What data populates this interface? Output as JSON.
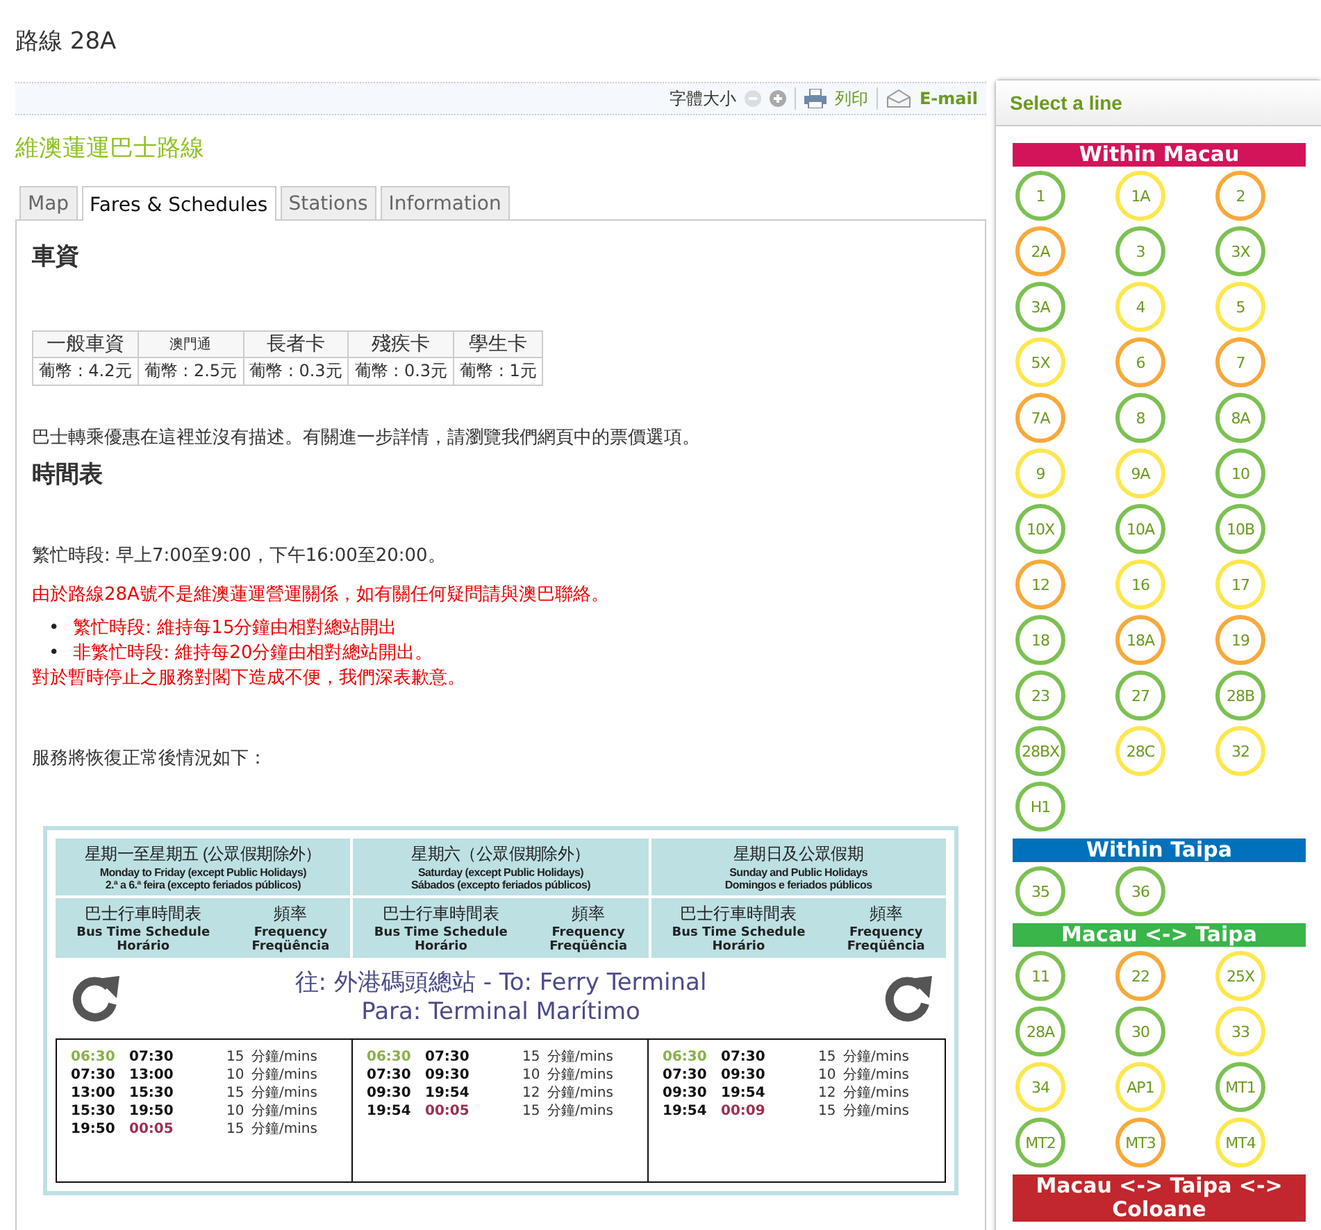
{
  "page_title": "路線 28A",
  "toolbar": {
    "font_size_label": "字體大小",
    "print": "列印",
    "email": "E-mail"
  },
  "heading": "維澳蓮運巴士路線",
  "tabs": [
    {
      "label": "Map",
      "selected": false
    },
    {
      "label": "Fares & Schedules",
      "selected": true
    },
    {
      "label": "Stations",
      "selected": false
    },
    {
      "label": "Information",
      "selected": false
    }
  ],
  "fares": {
    "title": "車資",
    "headers": [
      "一般車資",
      "澳門通",
      "長者卡",
      "殘疾卡",
      "學生卡"
    ],
    "values": [
      "葡幣 : 4.2元",
      "葡幣 : 2.5元",
      "葡幣 : 0.3元",
      "葡幣 : 0.3元",
      "葡幣 : 1元"
    ]
  },
  "transfer_note": "巴士轉乘優惠在這裡並沒有描述。有關進一步詳情，請瀏覽我們網頁中的票價選項。",
  "schedule_title": "時間表",
  "peak_hours": "繁忙時段: 早上7:00至9:00，下午16:00至20:00。",
  "notice": "由於路線28A號不是維澳蓮運營運關係，如有關任何疑問請與澳巴聯絡。",
  "notice_items": [
    {
      "bullet": "•",
      "text": "繁忙時段: 維持每15分鐘由相對總站開出"
    },
    {
      "bullet": "•",
      "text": "非繁忙時段: 維持每20分鐘由相對總站開出。"
    }
  ],
  "apology": "對於暫時停止之服務對閣下造成不便，我們深表歉意。",
  "resume_note": "服務將恢復正常後情況如下：",
  "timetable": {
    "destination": [
      "往: 外港碼頭總站 -  To: Ferry Terminal",
      "Para: Terminal Marítimo"
    ],
    "days": [
      {
        "title": [
          "星期一至星期五 (公眾假期除外）",
          "Monday to Friday (except Public Holidays)",
          "2.ª a 6.ª feira (excepto feriados públicos)"
        ],
        "schedule_head": [
          "巴士行車時間表",
          "Bus Time Schedule",
          "Horário"
        ],
        "frequency_head": [
          "頻率",
          "Frequency",
          "Freqüência"
        ],
        "rows": [
          {
            "start": {
              "text": "06:30",
              "color": "#8ab04a"
            },
            "end": {
              "text": "07:30",
              "color": "#111111"
            },
            "freq": "15",
            "unit": "分鐘/mins"
          },
          {
            "start": {
              "text": "07:30",
              "color": "#111111"
            },
            "end": {
              "text": "13:00",
              "color": "#111111"
            },
            "freq": "10",
            "unit": "分鐘/mins"
          },
          {
            "start": {
              "text": "13:00",
              "color": "#111111"
            },
            "end": {
              "text": "15:30",
              "color": "#111111"
            },
            "freq": "15",
            "unit": "分鐘/mins"
          },
          {
            "start": {
              "text": "15:30",
              "color": "#111111"
            },
            "end": {
              "text": "19:50",
              "color": "#111111"
            },
            "freq": "10",
            "unit": "分鐘/mins"
          },
          {
            "start": {
              "text": "19:50",
              "color": "#111111"
            },
            "end": {
              "text": "00:05",
              "color": "#9b3050"
            },
            "freq": "15",
            "unit": "分鐘/mins"
          }
        ]
      },
      {
        "title": [
          "星期六（公眾假期除外）",
          "Saturday (except Public Holidays)",
          "Sábados (excepto feriados públicos)"
        ],
        "schedule_head": [
          "巴士行車時間表",
          "Bus Time Schedule",
          "Horário"
        ],
        "frequency_head": [
          "頻率",
          "Frequency",
          "Freqüência"
        ],
        "rows": [
          {
            "start": {
              "text": "06:30",
              "color": "#8ab04a"
            },
            "end": {
              "text": "07:30",
              "color": "#111111"
            },
            "freq": "15",
            "unit": "分鐘/mins"
          },
          {
            "start": {
              "text": "07:30",
              "color": "#111111"
            },
            "end": {
              "text": "09:30",
              "color": "#111111"
            },
            "freq": "10",
            "unit": "分鐘/mins"
          },
          {
            "start": {
              "text": "09:30",
              "color": "#111111"
            },
            "end": {
              "text": "19:54",
              "color": "#111111"
            },
            "freq": "12",
            "unit": "分鐘/mins"
          },
          {
            "start": {
              "text": "19:54",
              "color": "#111111"
            },
            "end": {
              "text": "00:05",
              "color": "#9b3050"
            },
            "freq": "15",
            "unit": "分鐘/mins"
          }
        ]
      },
      {
        "title": [
          "星期日及公眾假期",
          "Sunday and Public Holidays",
          "Domingos e feriados públicos"
        ],
        "schedule_head": [
          "巴士行車時間表",
          "Bus Time Schedule",
          "Horário"
        ],
        "frequency_head": [
          "頻率",
          "Frequency",
          "Freqüência"
        ],
        "rows": [
          {
            "start": {
              "text": "06:30",
              "color": "#8ab04a"
            },
            "end": {
              "text": "07:30",
              "color": "#111111"
            },
            "freq": "15",
            "unit": "分鐘/mins"
          },
          {
            "start": {
              "text": "07:30",
              "color": "#111111"
            },
            "end": {
              "text": "09:30",
              "color": "#111111"
            },
            "freq": "10",
            "unit": "分鐘/mins"
          },
          {
            "start": {
              "text": "09:30",
              "color": "#111111"
            },
            "end": {
              "text": "19:54",
              "color": "#111111"
            },
            "freq": "12",
            "unit": "分鐘/mins"
          },
          {
            "start": {
              "text": "19:54",
              "color": "#111111"
            },
            "end": {
              "text": "00:09",
              "color": "#9b3050"
            },
            "freq": "15",
            "unit": "分鐘/mins"
          }
        ]
      }
    ]
  },
  "sidebar": {
    "title": "Select a line",
    "groups": [
      {
        "title": "Within Macau",
        "color": "#d3145a",
        "lines": [
          {
            "label": "1",
            "color": "#7cc152"
          },
          {
            "label": "1A",
            "color": "#fde74c"
          },
          {
            "label": "2",
            "color": "#f7a93a"
          },
          {
            "label": "2A",
            "color": "#f7a93a"
          },
          {
            "label": "3",
            "color": "#7cc152"
          },
          {
            "label": "3X",
            "color": "#7cc152"
          },
          {
            "label": "3A",
            "color": "#7cc152"
          },
          {
            "label": "4",
            "color": "#fde74c"
          },
          {
            "label": "5",
            "color": "#fde74c"
          },
          {
            "label": "5X",
            "color": "#fde74c"
          },
          {
            "label": "6",
            "color": "#f7a93a"
          },
          {
            "label": "7",
            "color": "#f7a93a"
          },
          {
            "label": "7A",
            "color": "#f7a93a"
          },
          {
            "label": "8",
            "color": "#7cc152"
          },
          {
            "label": "8A",
            "color": "#7cc152"
          },
          {
            "label": "9",
            "color": "#fde74c"
          },
          {
            "label": "9A",
            "color": "#fde74c"
          },
          {
            "label": "10",
            "color": "#7cc152"
          },
          {
            "label": "10X",
            "color": "#7cc152"
          },
          {
            "label": "10A",
            "color": "#7cc152"
          },
          {
            "label": "10B",
            "color": "#7cc152"
          },
          {
            "label": "12",
            "color": "#f7a93a"
          },
          {
            "label": "16",
            "color": "#fde74c"
          },
          {
            "label": "17",
            "color": "#fde74c"
          },
          {
            "label": "18",
            "color": "#7cc152"
          },
          {
            "label": "18A",
            "color": "#f7a93a"
          },
          {
            "label": "19",
            "color": "#f7a93a"
          },
          {
            "label": "23",
            "color": "#7cc152"
          },
          {
            "label": "27",
            "color": "#7cc152"
          },
          {
            "label": "28B",
            "color": "#7cc152"
          },
          {
            "label": "28BX",
            "color": "#7cc152"
          },
          {
            "label": "28C",
            "color": "#fde74c"
          },
          {
            "label": "32",
            "color": "#fde74c"
          },
          {
            "label": "H1",
            "color": "#7cc152"
          }
        ]
      },
      {
        "title": "Within Taipa",
        "color": "#0071bc",
        "lines": [
          {
            "label": "35",
            "color": "#7cc152"
          },
          {
            "label": "36",
            "color": "#7cc152"
          }
        ]
      },
      {
        "title": "Macau <-> Taipa",
        "color": "#39b54a",
        "lines": [
          {
            "label": "11",
            "color": "#7cc152"
          },
          {
            "label": "22",
            "color": "#f7a93a"
          },
          {
            "label": "25X",
            "color": "#fde74c"
          },
          {
            "label": "28A",
            "color": "#7cc152"
          },
          {
            "label": "30",
            "color": "#7cc152"
          },
          {
            "label": "33",
            "color": "#fde74c"
          },
          {
            "label": "34",
            "color": "#fde74c"
          },
          {
            "label": "AP1",
            "color": "#fde74c"
          },
          {
            "label": "MT1",
            "color": "#7cc152"
          },
          {
            "label": "MT2",
            "color": "#7cc152"
          },
          {
            "label": "MT3",
            "color": "#f7a93a"
          },
          {
            "label": "MT4",
            "color": "#fde74c"
          }
        ]
      },
      {
        "title": "Macau <-> Taipa <-> Coloane",
        "color": "#c1272d"
      }
    ]
  }
}
